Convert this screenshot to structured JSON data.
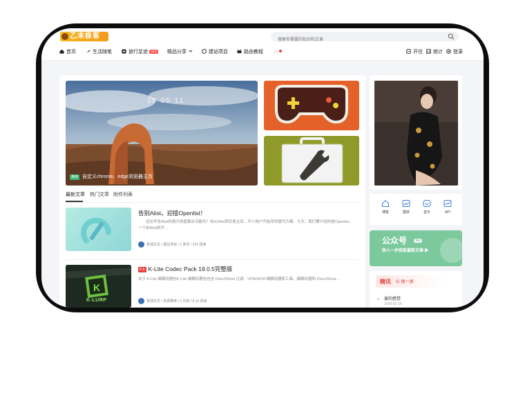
{
  "header": {
    "logo_text": "乙未极客",
    "search_placeholder": "搜索你需要的知识和文章"
  },
  "nav": {
    "items": [
      {
        "label": "首页",
        "icon": "home-icon"
      },
      {
        "label": "生活随笔",
        "icon": "feather-icon"
      },
      {
        "label": "旅行足迹",
        "icon": "compass-icon",
        "badge": "NEW"
      },
      {
        "label": "精品分享",
        "icon": "chevron-down-icon"
      },
      {
        "label": "建站项目",
        "icon": "shield-icon"
      },
      {
        "label": "路由教程",
        "icon": "router-icon"
      }
    ],
    "more_label": "···",
    "right": [
      {
        "label": "开往",
        "icon": "train-icon"
      },
      {
        "label": "统计",
        "icon": "chart-icon"
      },
      {
        "label": "登录",
        "icon": "login-icon"
      }
    ]
  },
  "hero": {
    "clock": "10 05 11",
    "tag": "推荐",
    "title": "自定义chrome、edge浏览器主页"
  },
  "tabs": [
    "最新文章",
    "热门文章",
    "附件列表"
  ],
  "articles": [
    {
      "title": "告别Alist，迎接Openlist！",
      "summary": "还在怀念Alist的强大网盘聚合功能吗？自从Alist项目易主后，不少用户开始寻找替代方案。今天，我们要介绍的是Openlist，一个由Alist原开...",
      "meta": "意润乐见 / 建站项目 / 1 条评 / 222 阅读"
    },
    {
      "tag": "K-lt",
      "title": "K-Lite Codec Pack 19.0.5完整版",
      "summary": "关于 K-Lite 编解码器包K-Lite 编解码器包包含 DirectShow 过滤、VFW/ACM 编解码器和工具。编解码器和 DirectShow ...",
      "meta": "意润乐见 / 资源推荐 / 1 日前 / 9.1k 阅读",
      "thumb_text": "K-LURP"
    }
  ],
  "tools": [
    {
      "label": "博客",
      "icon": "house-icon"
    },
    {
      "label": "图床",
      "icon": "image-icon"
    },
    {
      "label": "音乐",
      "icon": "music-icon"
    },
    {
      "label": "API",
      "icon": "api-icon"
    }
  ],
  "wechat": {
    "title": "公众号",
    "badge": "更新",
    "subtitle": "快人一步获取最新文章 ▶"
  },
  "hot": {
    "title": "精讯",
    "refresh": "换一换",
    "items": [
      {
        "title": "爱的感觉",
        "date": "2020-02-16"
      }
    ]
  },
  "colors": {
    "accent_green": "#7cc99e",
    "hot_red": "#e2413a",
    "tile_orange": "#e5612a",
    "tile_olive": "#8f9a2b"
  }
}
